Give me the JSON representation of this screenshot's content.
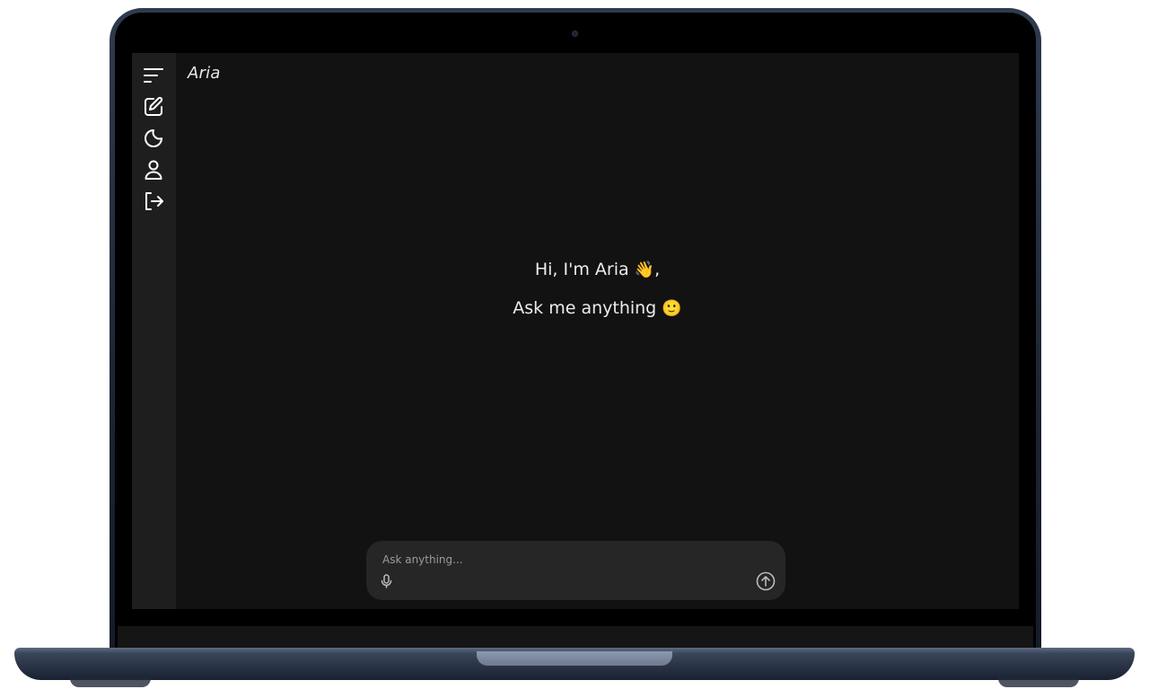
{
  "app": {
    "title": "Aria"
  },
  "sidebar": {
    "items": [
      {
        "icon": "menu-icon"
      },
      {
        "icon": "new-chat-icon"
      },
      {
        "icon": "moon-icon"
      },
      {
        "icon": "user-icon"
      },
      {
        "icon": "logout-icon"
      }
    ]
  },
  "greeting": {
    "line1": "Hi, I'm Aria",
    "line1_emoji": "👋",
    "line1_suffix": ",",
    "line2": "Ask me anything",
    "line2_emoji": "🙂"
  },
  "composer": {
    "placeholder": "Ask anything...",
    "value": "",
    "mic_icon": "microphone-icon",
    "send_icon": "send-arrow-up-icon"
  },
  "colors": {
    "screen_bg": "#121212",
    "sidebar_bg": "#1e1e1e",
    "composer_bg": "#262626",
    "text": "#ececec",
    "icon": "#ffffff"
  }
}
